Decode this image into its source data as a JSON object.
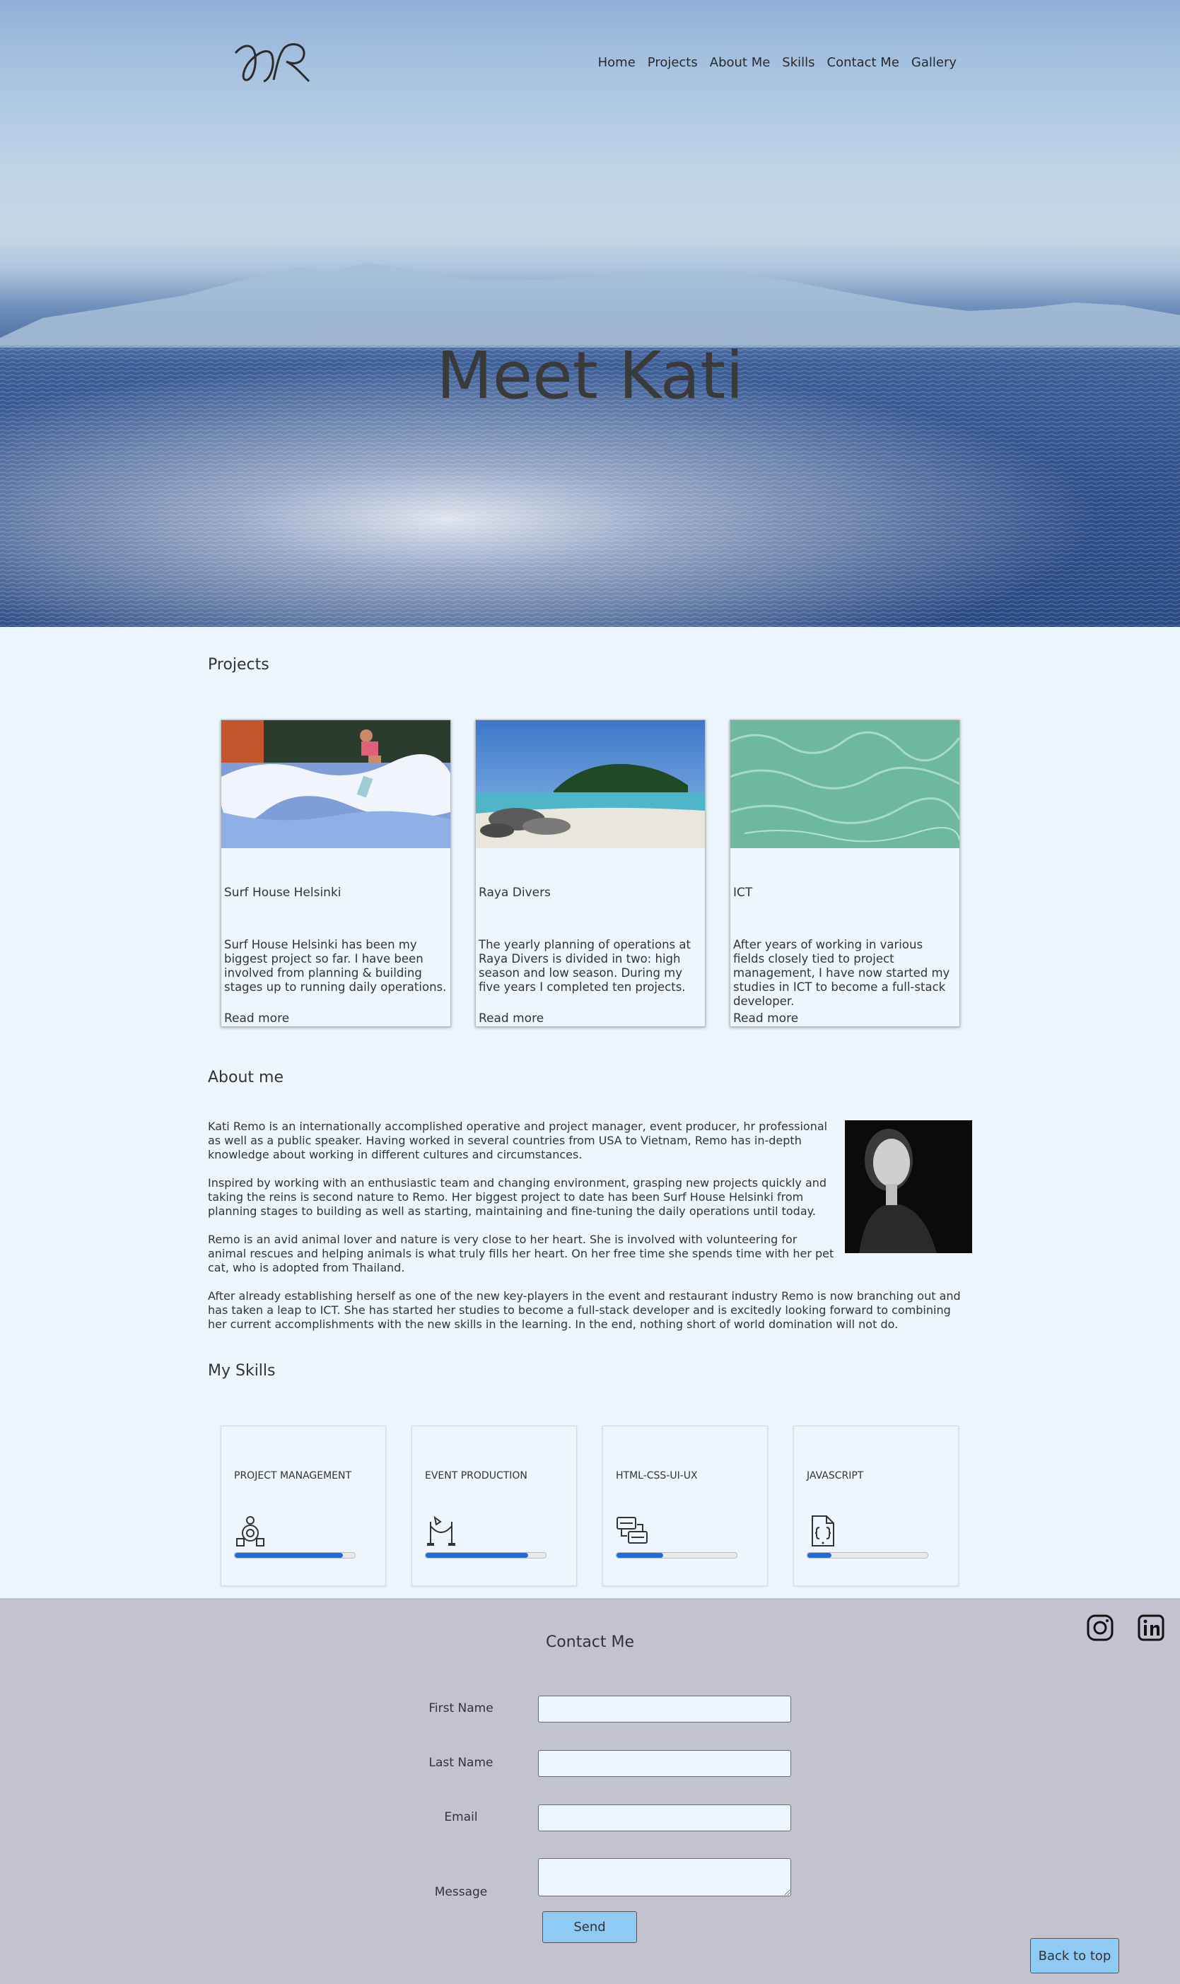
{
  "nav": {
    "items": [
      "Home",
      "Projects",
      "About Me",
      "Skills",
      "Contact Me",
      "Gallery"
    ]
  },
  "hero": {
    "title": "Meet Kati"
  },
  "projects": {
    "title": "Projects",
    "cards": [
      {
        "title": "Surf House Helsinki",
        "description": "Surf House Helsinki has been my biggest project so far. I have been involved from planning & building stages up to running daily operations.",
        "link": "Read more"
      },
      {
        "title": "Raya Divers",
        "description": "The yearly planning of operations at Raya Divers is divided in two: high season and low season. During my five years I completed ten projects.",
        "link": "Read more"
      },
      {
        "title": "ICT",
        "description": "After years of working in various fields closely tied to project management, I have now started my studies in ICT to become a full-stack developer.",
        "link": "Read more"
      }
    ]
  },
  "about": {
    "title": "About me",
    "paragraphs": [
      "Kati Remo is an internationally accomplished operative and project manager, event producer, hr professional as well as a public speaker. Having worked in several countries from USA to Vietnam, Remo has in-depth knowledge about working in different cultures and circumstances.",
      "Inspired by working with an enthusiastic team and changing environment, grasping new projects quickly and taking the reins is second nature to Remo. Her biggest project to date has been Surf House Helsinki from planning stages to building as well as starting, maintaining and fine-tuning the daily operations until today.",
      "Remo is an avid animal lover and nature is very close to her heart. She is involved with volunteering for animal rescues and helping animals is what truly fills her heart. On her free time she spends time with her pet cat, who is adopted from Thailand.",
      "After already establishing herself as one of the new key-players in the event and restaurant industry Remo is now branching out and has taken a leap to ICT. She has started her studies to become a full-stack developer and is excitedly looking forward to combining her current accomplishments with the new skills in the learning. In the end, nothing short of world domination will not do."
    ]
  },
  "skills": {
    "title": "My Skills",
    "items": [
      {
        "name": "Project Management",
        "icon": "project-management-icon",
        "level": 0.9
      },
      {
        "name": "Event Production",
        "icon": "event-production-icon",
        "level": 0.85
      },
      {
        "name": "HTML-CSS-UI-UX",
        "icon": "html-css-icon",
        "level": 0.39
      },
      {
        "name": "JavaScript",
        "icon": "javascript-file-icon",
        "level": 0.2
      }
    ],
    "bar_color": "#1a6fe0"
  },
  "contact": {
    "title": "Contact Me",
    "fields": {
      "first_name": {
        "label": "First Name",
        "value": ""
      },
      "last_name": {
        "label": "Last Name",
        "value": ""
      },
      "email": {
        "label": "Email",
        "value": ""
      },
      "message": {
        "label": "Message",
        "value": ""
      }
    },
    "send_label": "Send",
    "back_to_top_label": "Back to top",
    "social": [
      "instagram-icon",
      "linkedin-icon"
    ]
  },
  "colors": {
    "page_bg": "#eef6fd",
    "contact_bg": "#c3c3d0",
    "button_bg": "#8ecaf4"
  }
}
